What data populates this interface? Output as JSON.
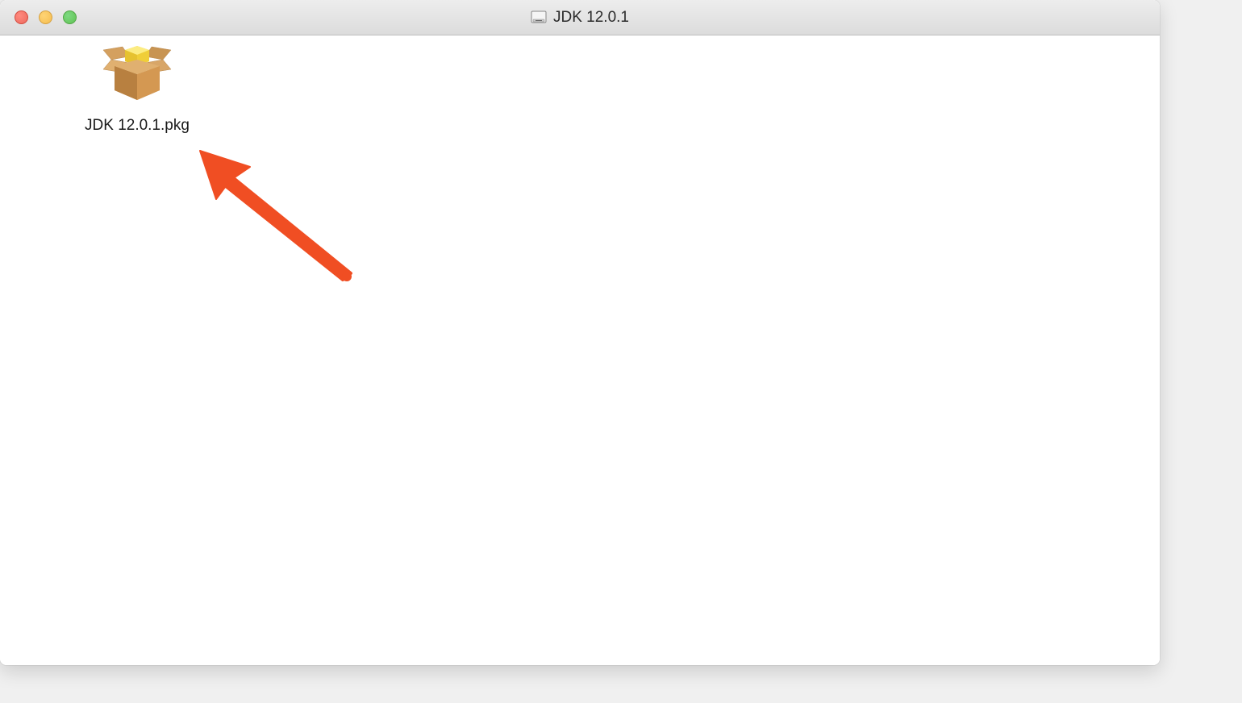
{
  "window": {
    "title": "JDK 12.0.1"
  },
  "file": {
    "name": "JDK 12.0.1.pkg"
  },
  "annotation": {
    "arrow_color": "#F04E23"
  }
}
